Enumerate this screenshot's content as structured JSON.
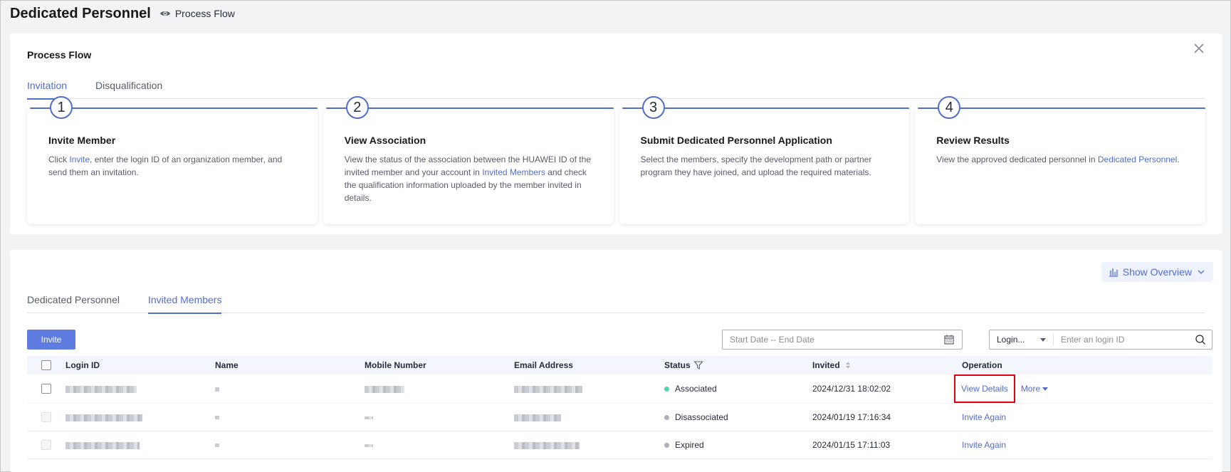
{
  "page": {
    "title": "Dedicated Personnel",
    "process_flow_link": "Process Flow"
  },
  "flow": {
    "title": "Process Flow",
    "tabs": [
      {
        "label": "Invitation",
        "active": true
      },
      {
        "label": "Disqualification",
        "active": false
      }
    ],
    "steps": [
      {
        "num": "1",
        "title": "Invite Member",
        "desc_pre": "Click ",
        "link": "Invite",
        "desc_post": ", enter the login ID of an organization member, and send them an invitation."
      },
      {
        "num": "2",
        "title": "View Association",
        "desc_pre": "View the status of the association between the HUAWEI ID of the invited member and your account in ",
        "link": "Invited Members",
        "desc_post": " and check the qualification information uploaded by the member invited in details."
      },
      {
        "num": "3",
        "title": "Submit Dedicated Personnel Application",
        "desc_pre": "Select the members, specify the development path or partner program they have joined, and upload the required materials.",
        "link": "",
        "desc_post": ""
      },
      {
        "num": "4",
        "title": "Review Results",
        "desc_pre": "View the approved dedicated personnel in ",
        "link": "Dedicated Personnel",
        "desc_post": "."
      }
    ]
  },
  "members": {
    "show_overview": "Show Overview",
    "tabs": [
      {
        "label": "Dedicated Personnel",
        "active": false
      },
      {
        "label": "Invited Members",
        "active": true
      }
    ],
    "invite_button": "Invite",
    "date_placeholder": "Start Date -- End Date",
    "login_select": "Login...",
    "login_placeholder": "Enter an login ID",
    "columns": [
      "Login ID",
      "Name",
      "Mobile Number",
      "Email Address",
      "Status",
      "Invited",
      "Operation"
    ],
    "rows": [
      {
        "status": "Associated",
        "status_color": "#50d4ab",
        "invited": "2024/12/31 18:02:02",
        "ops": [
          "View Details",
          "More"
        ]
      },
      {
        "status": "Disassociated",
        "status_color": "#adb0b8",
        "invited": "2024/01/19 17:16:34",
        "ops": [
          "Invite Again"
        ]
      },
      {
        "status": "Expired",
        "status_color": "#adb0b8",
        "invited": "2024/01/15 17:11:03",
        "ops": [
          "Invite Again"
        ]
      }
    ]
  },
  "colors": {
    "accent": "#526ecc",
    "primary_button": "#5e7ce0",
    "highlight_box": "#e3000e"
  }
}
